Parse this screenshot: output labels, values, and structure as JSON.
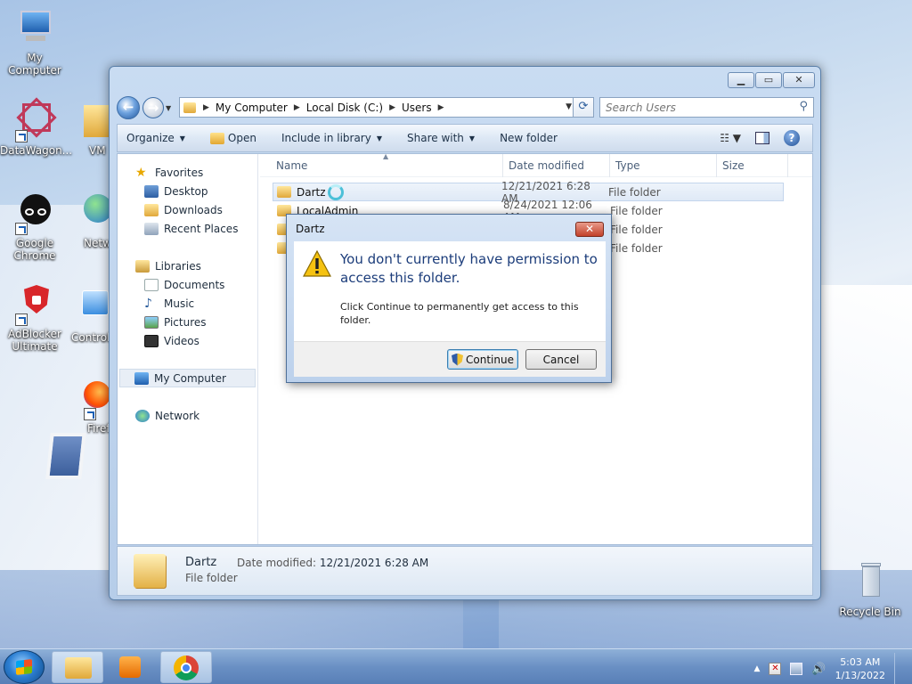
{
  "desktop": {
    "icons": [
      {
        "label": "My Computer"
      },
      {
        "label": "DataWagon..."
      },
      {
        "label": "VM"
      },
      {
        "label": "Google Chrome"
      },
      {
        "label": "Netw"
      },
      {
        "label": "AdBlocker Ultimate"
      },
      {
        "label": "Control"
      },
      {
        "label": "Firef"
      },
      {
        "label": "Recycle Bin"
      }
    ]
  },
  "explorer": {
    "breadcrumb": [
      "My Computer",
      "Local Disk (C:)",
      "Users"
    ],
    "search_placeholder": "Search Users",
    "toolbar": {
      "organize": "Organize",
      "open": "Open",
      "include": "Include in library",
      "share": "Share with",
      "new_folder": "New folder"
    },
    "nav": {
      "favorites": "Favorites",
      "desktop": "Desktop",
      "downloads": "Downloads",
      "recent": "Recent Places",
      "libraries": "Libraries",
      "documents": "Documents",
      "music": "Music",
      "pictures": "Pictures",
      "videos": "Videos",
      "computer": "My Computer",
      "network": "Network"
    },
    "columns": {
      "name": "Name",
      "date": "Date modified",
      "type": "Type",
      "size": "Size"
    },
    "files": [
      {
        "name": "Dartz",
        "date": "12/21/2021 6:28 AM",
        "type": "File folder"
      },
      {
        "name": "LocalAdmin",
        "date": "8/24/2021 12:06 AM",
        "type": "File folder"
      },
      {
        "name": "",
        "date": "",
        "type": "File folder"
      },
      {
        "name": "",
        "date": "",
        "type": "File folder"
      }
    ],
    "details": {
      "name": "Dartz",
      "date_label": "Date modified:",
      "date_value": "12/21/2021 6:28 AM",
      "type": "File folder"
    }
  },
  "dialog": {
    "title": "Dartz",
    "main": "You don't currently have permission to access this folder.",
    "sub": "Click Continue to permanently get access to this folder.",
    "continue": "Continue",
    "cancel": "Cancel"
  },
  "taskbar": {
    "time": "5:03 AM",
    "date": "1/13/2022"
  }
}
